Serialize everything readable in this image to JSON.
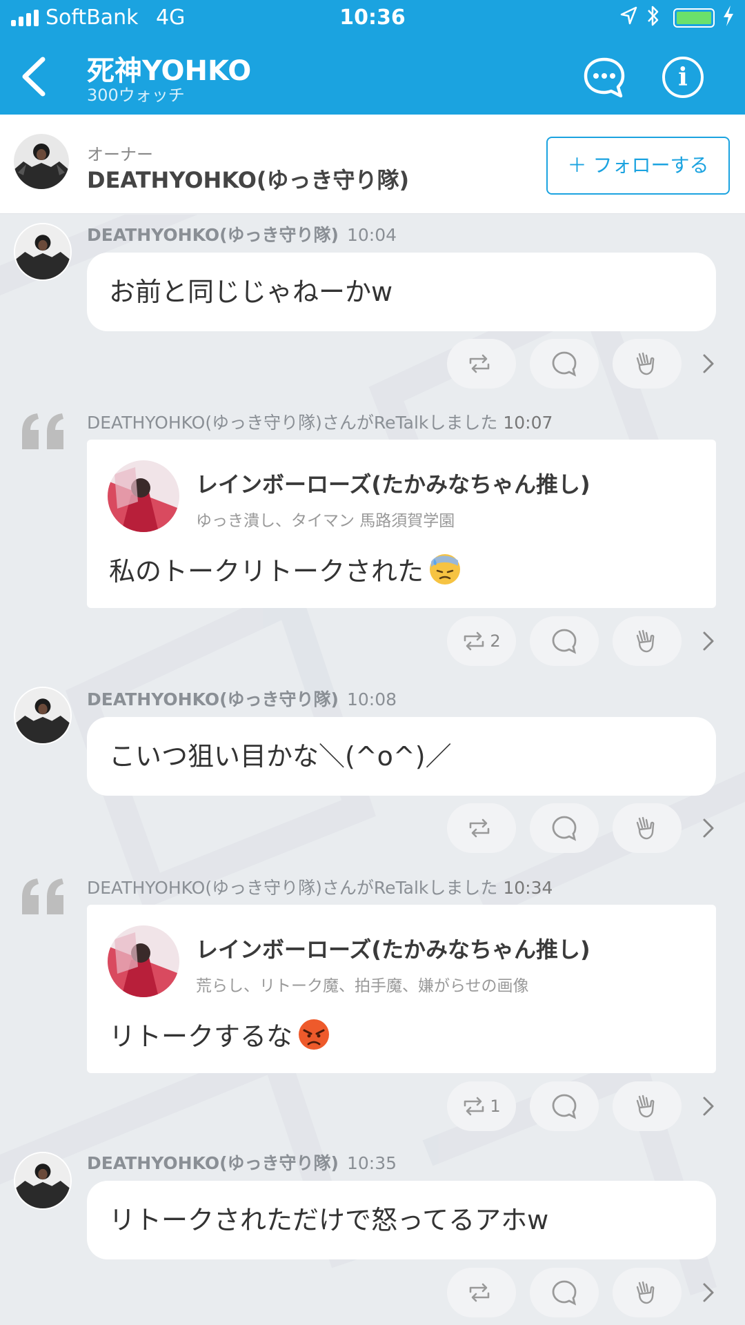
{
  "status_bar": {
    "carrier": "SoftBank",
    "network": "4G",
    "time": "10:36"
  },
  "nav": {
    "title": "死神YOHKO",
    "subtitle": "300ウォッチ",
    "info_glyph": "i"
  },
  "owner": {
    "label": "オーナー",
    "name": "DEATHYOHKO(ゆっき守り隊)",
    "follow_label": "＋ フォローする"
  },
  "colors": {
    "brand": "#1ba3e0",
    "background": "#e9ecef",
    "battery": "#6be16b"
  },
  "messages": [
    {
      "type": "message",
      "author": "DEATHYOHKO(ゆっき守り隊)",
      "time": "10:04",
      "text": "お前と同じじゃねーかw",
      "retalk_count": ""
    },
    {
      "type": "retalk",
      "header": "DEATHYOHKO(ゆっき守り隊)さんがReTalkしました",
      "time": "10:07",
      "quoted_author": "レインボーローズ(たかみなちゃん推し)",
      "quoted_bio": "ゆっき潰し、タイマン 馬路須賀学園",
      "quoted_text": "私のトークリトークされた",
      "emoji": "sweat-face-emoji",
      "retalk_count": "2"
    },
    {
      "type": "message",
      "author": "DEATHYOHKO(ゆっき守り隊)",
      "time": "10:08",
      "text": "こいつ狙い目かな＼(^o^)／",
      "retalk_count": ""
    },
    {
      "type": "retalk",
      "header": "DEATHYOHKO(ゆっき守り隊)さんがReTalkしました",
      "time": "10:34",
      "quoted_author": "レインボーローズ(たかみなちゃん推し)",
      "quoted_bio": "荒らし、リトーク魔、拍手魔、嫌がらせの画像",
      "quoted_text": "リトークするな",
      "emoji": "angry-face-emoji",
      "retalk_count": "1"
    },
    {
      "type": "message",
      "author": "DEATHYOHKO(ゆっき守り隊)",
      "time": "10:35",
      "text": "リトークされただけで怒ってるアホw",
      "retalk_count": ""
    }
  ]
}
